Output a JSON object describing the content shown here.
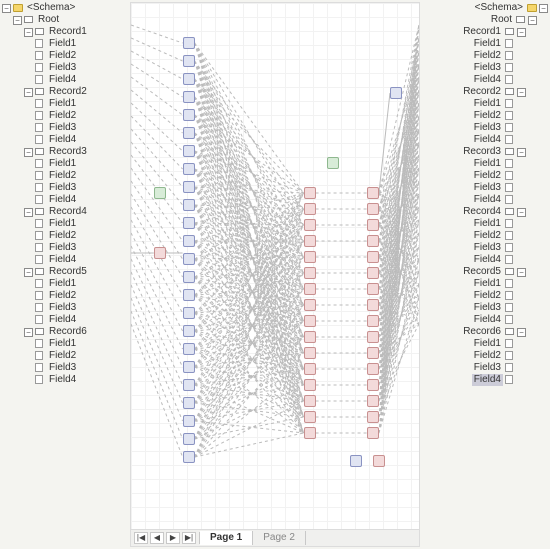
{
  "schemaLabel": "<Schema>",
  "rootLabel": "Root",
  "records": [
    "Record1",
    "Record2",
    "Record3",
    "Record4",
    "Record5",
    "Record6"
  ],
  "fields": [
    "Field1",
    "Field2",
    "Field3",
    "Field4"
  ],
  "selectedRight": "Field4",
  "nav": {
    "first": "|◀",
    "prev": "◀",
    "next": "▶",
    "last": "▶|"
  },
  "pages": [
    "Page 1",
    "Page 2"
  ],
  "activePage": 0,
  "expander": {
    "minus": "−",
    "plus": "+"
  }
}
